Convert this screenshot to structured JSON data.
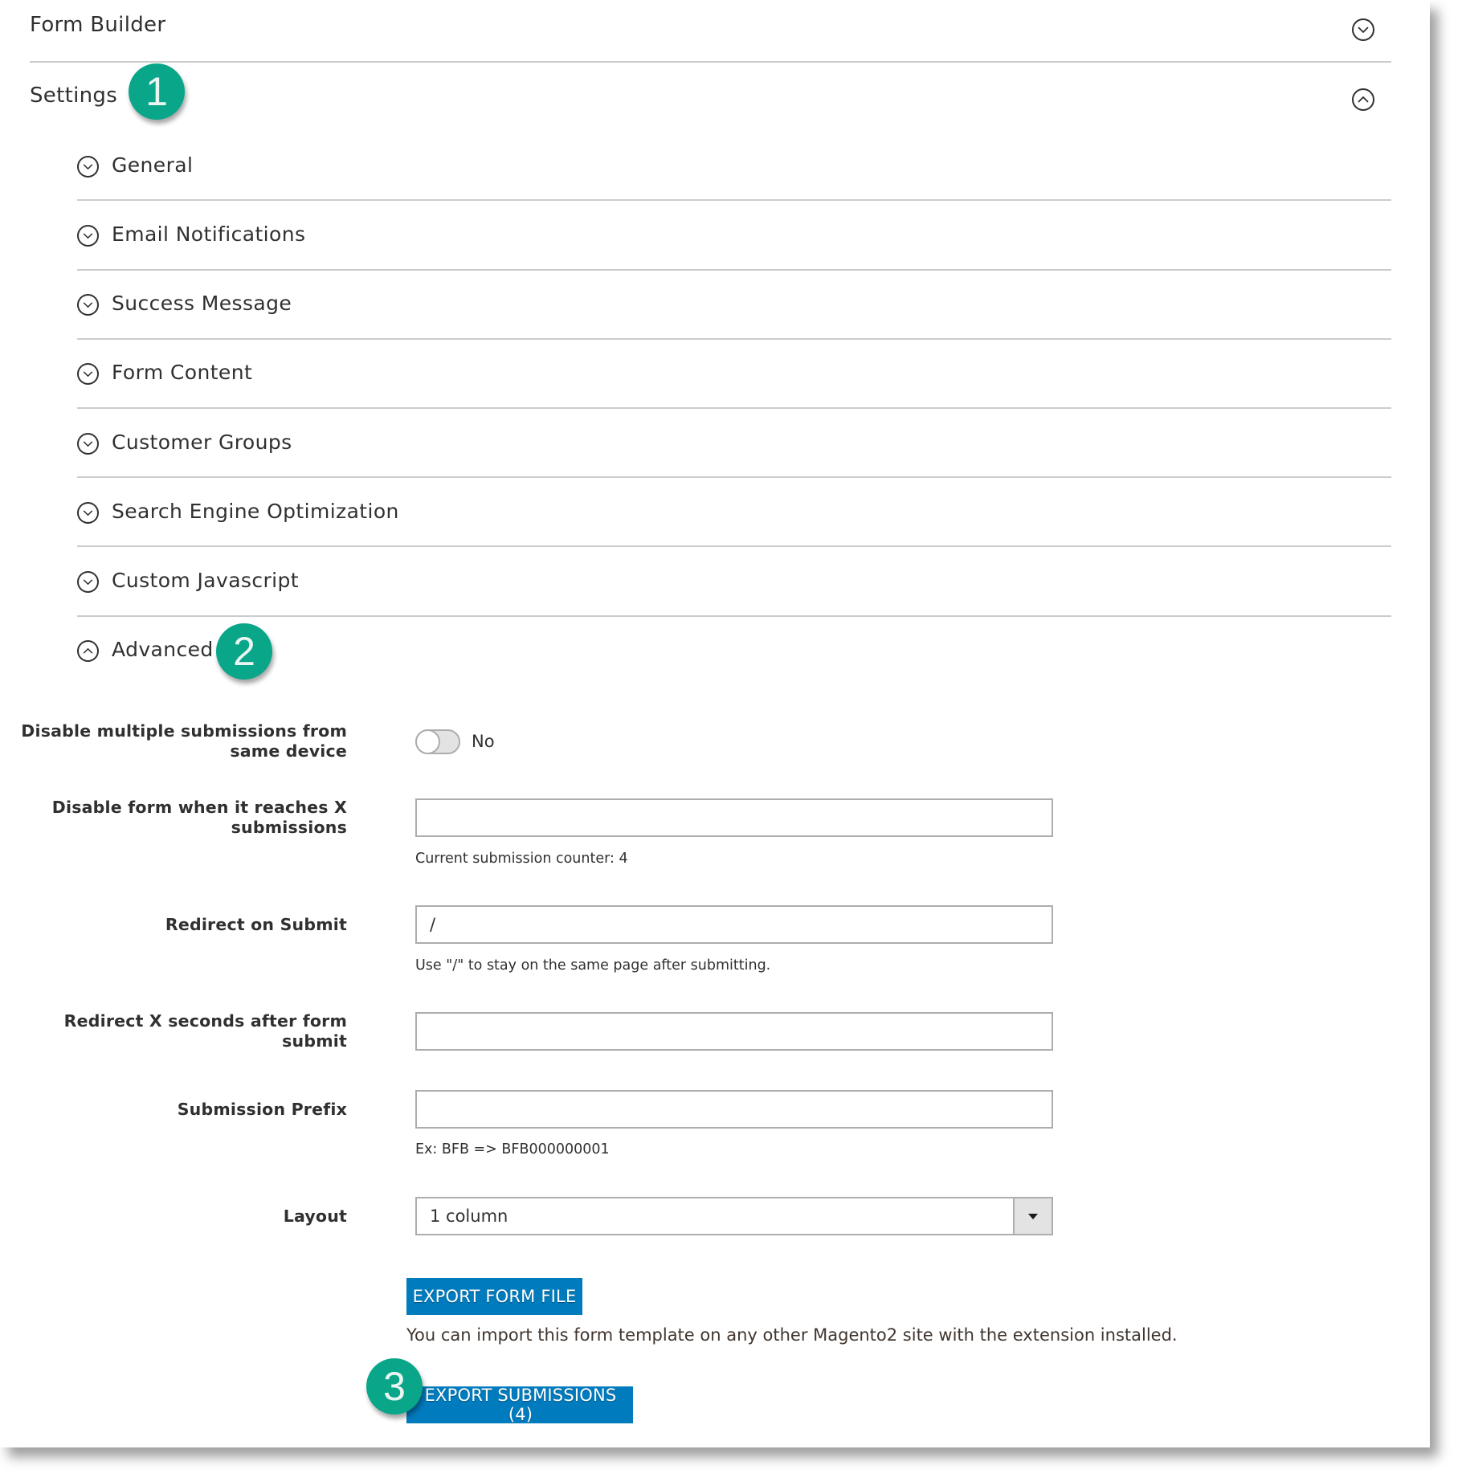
{
  "sections": {
    "form_builder": {
      "title": "Form Builder",
      "state": "collapsed"
    },
    "settings": {
      "title": "Settings",
      "state": "expanded",
      "badge": "1"
    }
  },
  "subsections": [
    {
      "label": "General",
      "state": "collapsed"
    },
    {
      "label": "Email Notifications",
      "state": "collapsed"
    },
    {
      "label": "Success Message",
      "state": "collapsed"
    },
    {
      "label": "Form Content",
      "state": "collapsed"
    },
    {
      "label": "Customer Groups",
      "state": "collapsed"
    },
    {
      "label": "Search Engine Optimization",
      "state": "collapsed"
    },
    {
      "label": "Custom Javascript",
      "state": "collapsed"
    },
    {
      "label": "Advanced",
      "state": "expanded",
      "badge": "2"
    }
  ],
  "advanced": {
    "disable_multiple": {
      "label": "Disable multiple submissions from same device",
      "value_label": "No",
      "enabled": false
    },
    "disable_form_limit": {
      "label": "Disable form when it reaches X submissions",
      "value": "",
      "helper": "Current submission counter: 4"
    },
    "redirect_on_submit": {
      "label": "Redirect on Submit",
      "value": "/",
      "helper": "Use \"/\" to stay on the same page after submitting."
    },
    "redirect_seconds": {
      "label": "Redirect X seconds after form submit",
      "value": ""
    },
    "submission_prefix": {
      "label": "Submission Prefix",
      "value": "",
      "helper": "Ex: BFB => BFB000000001"
    },
    "layout": {
      "label": "Layout",
      "selected": "1 column"
    },
    "export_form_button": "EXPORT FORM FILE",
    "export_form_note": "You can import this form template on any other Magento2 site with the extension installed.",
    "export_submissions_button": "EXPORT SUBMISSIONS (4)",
    "export_badge": "3"
  },
  "colors": {
    "badge": "#0aa68a",
    "button": "#007bbd",
    "divider": "#cccccc",
    "text": "#303030"
  }
}
